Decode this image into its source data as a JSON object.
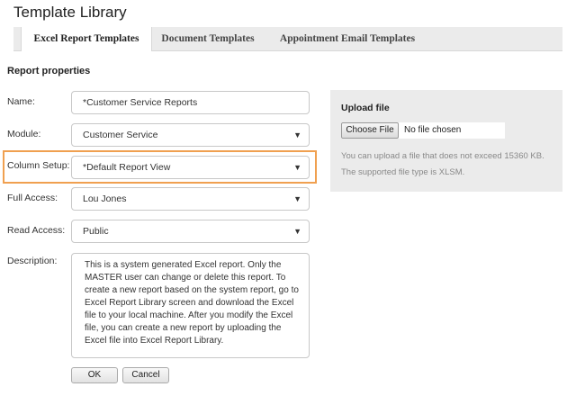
{
  "page_title": "Template Library",
  "tabs": [
    {
      "label": "Excel Report Templates",
      "active": true
    },
    {
      "label": "Document Templates",
      "active": false
    },
    {
      "label": "Appointment Email Templates",
      "active": false
    }
  ],
  "section_title": "Report properties",
  "form": {
    "name": {
      "label": "Name:",
      "value": "*Customer Service Reports"
    },
    "module": {
      "label": "Module:",
      "value": "Customer Service"
    },
    "column_setup": {
      "label": "Column Setup:",
      "value": "*Default Report View"
    },
    "full_access": {
      "label": "Full Access:",
      "value": "Lou Jones"
    },
    "read_access": {
      "label": "Read Access:",
      "value": "Public"
    },
    "description": {
      "label": "Description:",
      "value": "This is a system generated Excel report. Only the MASTER user can change or delete this report. To create a new report based on the system report, go to Excel Report Library screen and download the Excel file to your local machine. After you modify the Excel file, you can create a new report by uploading the Excel file into Excel Report Library."
    }
  },
  "buttons": {
    "ok": "OK",
    "cancel": "Cancel"
  },
  "upload": {
    "title": "Upload file",
    "choose_label": "Choose File",
    "no_file": "No file chosen",
    "note_line1": "You can upload a file that does not exceed 15360 KB.",
    "note_line2": "The supported file type is XLSM."
  },
  "colors": {
    "highlight": "#f0a050",
    "panel_bg": "#ebebeb"
  },
  "icons": {
    "dropdown": "chevron-down-icon"
  }
}
